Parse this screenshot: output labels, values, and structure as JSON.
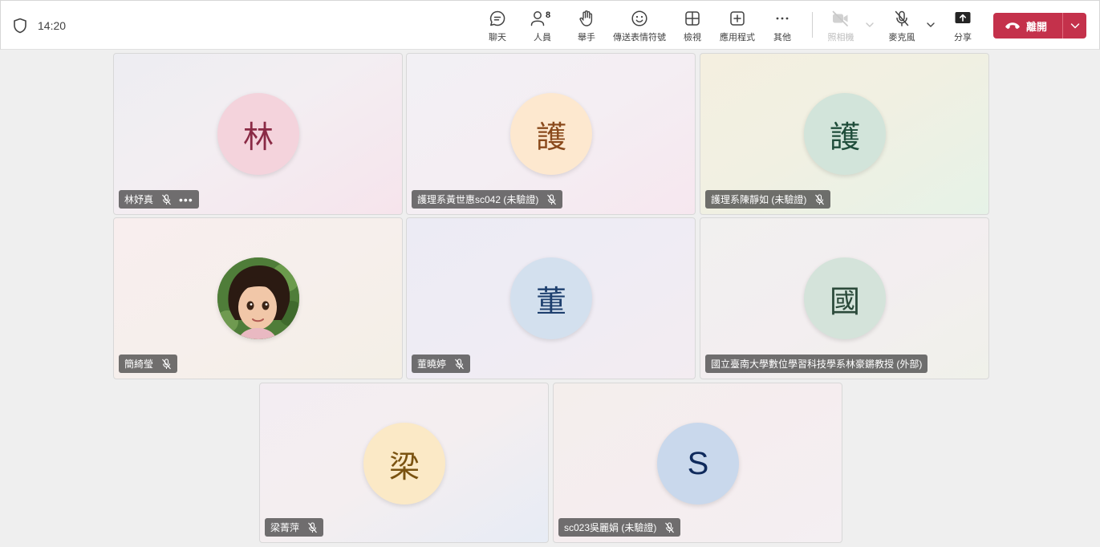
{
  "topbar": {
    "time": "14:20",
    "people_count": "8",
    "buttons": {
      "chat": "聊天",
      "people": "人員",
      "raise_hand": "舉手",
      "reactions": "傳送表情符號",
      "view": "檢視",
      "apps": "應用程式",
      "more": "其他",
      "camera": "照相機",
      "mic": "麥克風",
      "share": "分享"
    },
    "leave": "離開"
  },
  "participants": [
    {
      "name": "林妤真",
      "initial": "林",
      "avatar_bg": "#f4d3dc",
      "initial_color": "#8a2a45",
      "has_more": true
    },
    {
      "name": "護理系黃世惠sc042 (未驗證)",
      "initial": "護",
      "avatar_bg": "#fde8cf",
      "initial_color": "#8a4a1c",
      "has_more": false
    },
    {
      "name": "護理系陳靜如 (未驗證)",
      "initial": "護",
      "avatar_bg": "#d2e4da",
      "initial_color": "#1f4d3a",
      "has_more": false
    },
    {
      "name": "簡綺瑩",
      "initial": "",
      "avatar_bg": "#5d8a44",
      "initial_color": "#ffffff",
      "has_photo": true,
      "has_more": false
    },
    {
      "name": "董曉婷",
      "initial": "董",
      "avatar_bg": "#d3e0ee",
      "initial_color": "#1d3f6e",
      "has_more": false
    },
    {
      "name": "國立臺南大學數位學習科技學系林豪鏘教授 (外部)",
      "initial": "國",
      "avatar_bg": "#d4e3da",
      "initial_color": "#2b4a3a",
      "has_more": false
    },
    {
      "name": "梁菁萍",
      "initial": "梁",
      "avatar_bg": "#fbe9c6",
      "initial_color": "#7a5210",
      "has_more": false
    },
    {
      "name": "sc023吳麗娟 (未驗證)",
      "initial": "S",
      "avatar_bg": "#c9d8ec",
      "initial_color": "#0f2a5c",
      "has_more": false
    }
  ]
}
